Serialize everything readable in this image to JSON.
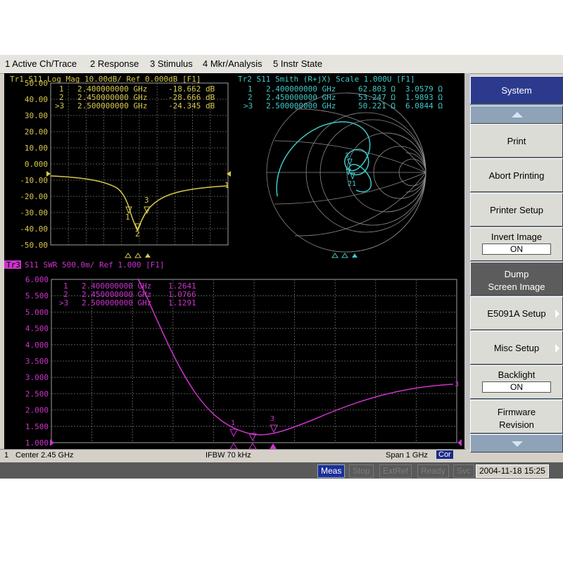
{
  "menu": [
    "1 Active Ch/Trace",
    "2 Response",
    "3 Stimulus",
    "4 Mkr/Analysis",
    "5 Instr State"
  ],
  "trace1": {
    "header": "Tr1 S11 Log Mag 10.00dB/ Ref 0.000dB [F1]",
    "color": "#d8c84a",
    "yticks": [
      "50.00",
      "40.00",
      "30.00",
      "20.00",
      "10.00",
      "0.000",
      "-10.00",
      "-20.00",
      "-30.00",
      "-40.00",
      "-50.00"
    ],
    "markers": [
      {
        "id": "1",
        "freq": "2.400000000 GHz",
        "val": "-18.662 dB"
      },
      {
        "id": "2",
        "freq": "2.450000000 GHz",
        "val": "-28.666 dB"
      },
      {
        "id": ">3",
        "freq": "2.500000000 GHz",
        "val": "-24.345 dB"
      }
    ],
    "end_label": "1"
  },
  "trace2": {
    "header": "Tr2 S11 Smith (R+jX) Scale 1.000U [F1]",
    "color": "#3ec8c8",
    "markers": [
      {
        "id": "1",
        "freq": "2.400000000 GHz",
        "r": "62.803 Ω",
        "x": "3.0579 Ω"
      },
      {
        "id": "2",
        "freq": "2.450000000 GHz",
        "r": "53.247 Ω",
        "x": "1.9893 Ω"
      },
      {
        "id": ">3",
        "freq": "2.500000000 GHz",
        "r": "50.221 Ω",
        "x": "6.0844 Ω"
      }
    ]
  },
  "trace3": {
    "header_tag": "Tr3",
    "header": "S11 SWR 500.0m/ Ref 1.000 [F1]",
    "color": "#cc33cc",
    "yticks": [
      "6.000",
      "5.500",
      "5.000",
      "4.500",
      "4.000",
      "3.500",
      "3.000",
      "2.500",
      "2.000",
      "1.500",
      "1.000"
    ],
    "markers": [
      {
        "id": "1",
        "freq": "2.400000000 GHz",
        "val": "1.2641"
      },
      {
        "id": "2",
        "freq": "2.450000000 GHz",
        "val": "1.0766"
      },
      {
        "id": ">3",
        "freq": "2.500000000 GHz",
        "val": "1.1291"
      }
    ],
    "end_label": "3"
  },
  "status": {
    "channel": "1",
    "center": "Center 2.45 GHz",
    "ifbw": "IFBW 70 kHz",
    "span": "Span 1 GHz",
    "cor": "Cor"
  },
  "bottom": {
    "meas": "Meas",
    "stop": "Stop",
    "extref": "ExtRef",
    "ready": "Ready",
    "svc": "Svc",
    "datetime": "2004-11-18 15:25"
  },
  "softkeys": {
    "title": "System",
    "print": "Print",
    "abort": "Abort Printing",
    "printer_setup": "Printer Setup",
    "invert_image": "Invert Image",
    "invert_image_state": "ON",
    "dump1": "Dump",
    "dump2": "Screen Image",
    "e5091a": "E5091A Setup",
    "misc": "Misc Setup",
    "backlight": "Backlight",
    "backlight_state": "ON",
    "firmware1": "Firmware",
    "firmware2": "Revision"
  }
}
